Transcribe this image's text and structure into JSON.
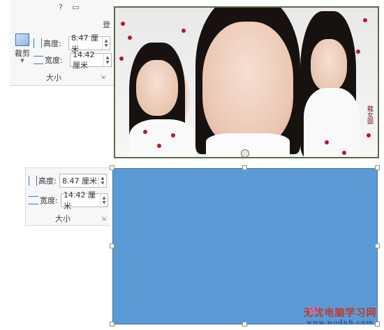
{
  "top_ribbon": {
    "help_icon": "?",
    "restore_icon": "▭",
    "sign_in": "登",
    "crop_label": "裁剪",
    "height_label": "高度:",
    "height_value": "8.47 厘米",
    "width_label": "宽度:",
    "width_value": "14.42 厘米",
    "group_label": "大小"
  },
  "bottom_ribbon": {
    "height_label": "高度:",
    "height_value": "8.47 厘米",
    "width_label": "宽度:",
    "width_value": "14.42 厘米",
    "group_label": "大小"
  },
  "photo": {
    "seal_text": "龍女圖"
  },
  "shape": {
    "fill_color": "#5b9bd5"
  },
  "watermark": {
    "logo": "W",
    "main": "无忧电脑学习网",
    "sub": "www.wodnh.com"
  }
}
